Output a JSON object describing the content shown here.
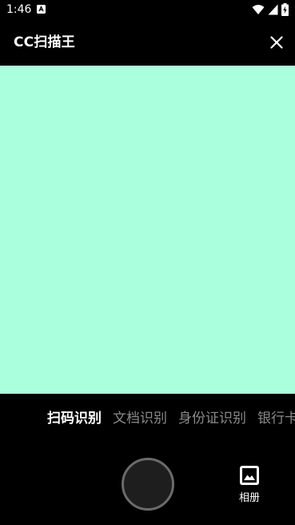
{
  "status_bar": {
    "time": "1:46",
    "notification_icon": "app-notification-icon",
    "right_icons": [
      "wifi-icon",
      "signal-icon",
      "battery-charging-icon"
    ]
  },
  "app_bar": {
    "title": "CC扫描王",
    "close_icon": "close-icon"
  },
  "preview": {
    "background_color": "#aaffdd"
  },
  "mode_tabs": [
    {
      "label": "扫码识别",
      "active": true
    },
    {
      "label": "文档识别",
      "active": false
    },
    {
      "label": "身份证识别",
      "active": false
    },
    {
      "label": "银行卡识别",
      "active": false
    }
  ],
  "bottom": {
    "shutter_icon": "shutter-button",
    "album_icon": "image-icon",
    "album_label": "相册"
  },
  "colors": {
    "background": "#000000",
    "active_tab": "#ffffff",
    "inactive_tab": "#8a8a8a",
    "shutter_fill": "#1e1e1e",
    "shutter_ring": "#6b6b6b"
  }
}
